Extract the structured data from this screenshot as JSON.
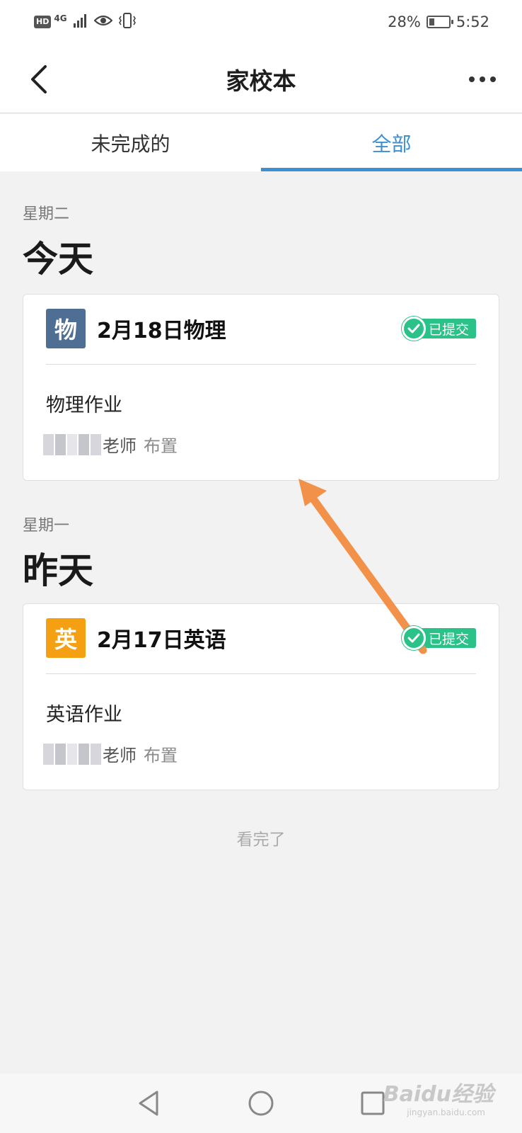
{
  "status_bar": {
    "hd": "HD",
    "network": "4G",
    "battery_text": "28%",
    "battery_level": 0.28,
    "time": "5:52"
  },
  "header": {
    "title": "家校本"
  },
  "tabs": [
    {
      "label": "未完成的",
      "active": false
    },
    {
      "label": "全部",
      "active": true
    }
  ],
  "sections": [
    {
      "weekday": "星期二",
      "day": "今天",
      "card": {
        "badge": "物",
        "badge_color": "#4f6e93",
        "title": "2月18日物理",
        "status": "已提交",
        "description": "物理作业",
        "teacher_suffix": "老师",
        "assigned": "布置"
      }
    },
    {
      "weekday": "星期一",
      "day": "昨天",
      "card": {
        "badge": "英",
        "badge_color": "#f5a013",
        "title": "2月17日英语",
        "status": "已提交",
        "description": "英语作业",
        "teacher_suffix": "老师",
        "assigned": "布置"
      }
    }
  ],
  "footer_text": "看完了",
  "colors": {
    "accent": "#3b8fd2",
    "submitted": "#2bc28a",
    "annotation_arrow": "#f2924a"
  },
  "watermark": {
    "brand": "Baidu经验",
    "url": "jingyan.baidu.com"
  }
}
